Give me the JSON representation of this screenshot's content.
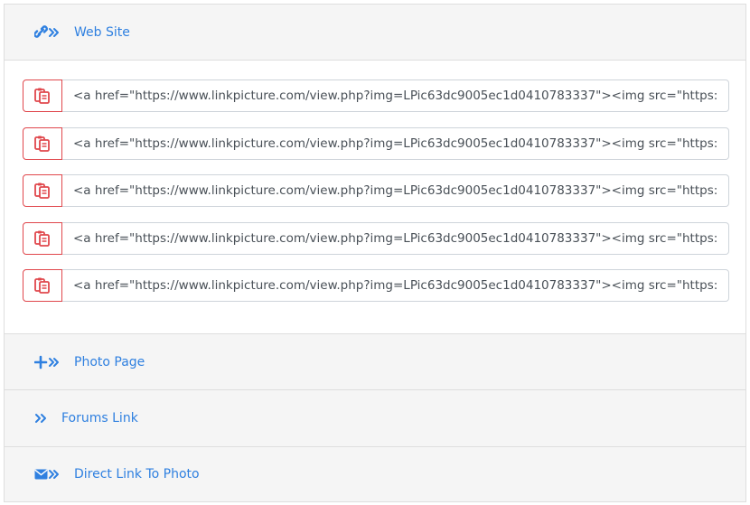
{
  "sections": {
    "website": {
      "label": "Web Site",
      "icon": "link-icon"
    },
    "photo_page": {
      "label": "Photo Page",
      "icon": "plus-icon"
    },
    "forums_link": {
      "label": "Forums Link",
      "icon": "double-chevron-icon"
    },
    "direct_link": {
      "label": "Direct Link To Photo",
      "icon": "envelope-icon"
    }
  },
  "codes": [
    "<a href=\"https://www.linkpicture.com/view.php?img=LPic63dc9005ec1d0410783337\"><img src=\"https://www.linkpicture.com/q/LPic63dc9005ec1d0410783337.jpg\" type=\"image\"></a>",
    "<a href=\"https://www.linkpicture.com/view.php?img=LPic63dc9005ec1d0410783337\"><img src=\"https://www.linkpicture.com/q/LPic63dc9005ec1d0410783337.jpg\" type=\"image\"></a>",
    "<a href=\"https://www.linkpicture.com/view.php?img=LPic63dc9005ec1d0410783337\"><img src=\"https://www.linkpicture.com/q/LPic63dc9005ec1d0410783337.jpg\" type=\"image\"></a>",
    "<a href=\"https://www.linkpicture.com/view.php?img=LPic63dc9005ec1d0410783337\"><img src=\"https://www.linkpicture.com/q/LPic63dc9005ec1d0410783337.jpg\" type=\"image\"></a>",
    "<a href=\"https://www.linkpicture.com/view.php?img=LPic63dc9005ec1d0410783337\"><img src=\"https://www.linkpicture.com/q/LPic63dc9005ec1d0410783337.jpg\" type=\"image\"></a>"
  ],
  "copy_icon": "copy-icon",
  "colors": {
    "accent_blue": "#2f80e0",
    "copy_red": "#e0474c",
    "header_bg": "#f5f5f5"
  }
}
